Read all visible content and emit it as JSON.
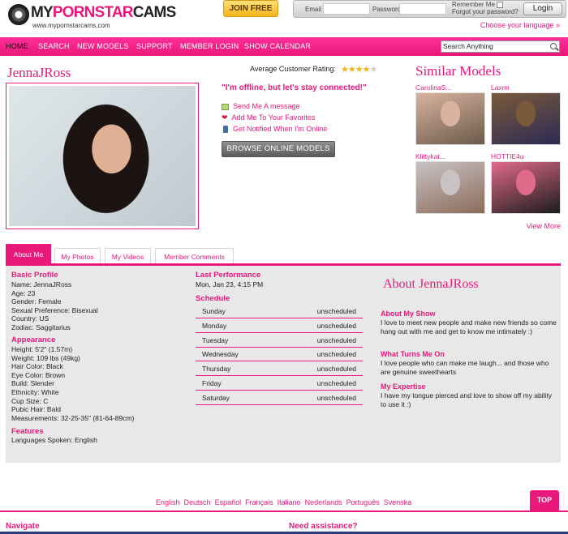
{
  "header": {
    "logo_text_a": "MY",
    "logo_text_b": "PORNSTAR",
    "logo_text_c": "CAMS",
    "logo_url": "www.mypornstarcams.com",
    "join_label": "JOIN FREE",
    "email_label": "Email",
    "password_label": "Password",
    "remember_label": "Remember Me",
    "forgot_label": "Forgot your password?",
    "login_label": "Login",
    "choose_language": "Choose your language »"
  },
  "nav": {
    "items": [
      "HOME",
      "SEARCH",
      "NEW MODELS",
      "SUPPORT",
      "MEMBER LOGIN",
      "SHOW CALENDAR"
    ],
    "search_placeholder": "Search Anything"
  },
  "profile": {
    "name": "JennaJRoss",
    "rating_label": "Average Customer Rating:",
    "rating": 4,
    "rating_max": 5,
    "offline_message": "\"I'm offline, but let's stay connected!\"",
    "actions": [
      "Send Me A message",
      "Add Me To Your Favorites",
      "Get Notified When I'm Online"
    ],
    "browse_label": "BROWSE ONLINE MODELS"
  },
  "similar": {
    "title": "Similar Models",
    "models": [
      {
        "name": "CarolinaS...",
        "color_a": "#d9b3a0",
        "color_b": "#6b5a4a"
      },
      {
        "name": "Laxmi",
        "color_a": "#7a5a3a",
        "color_b": "#2c2a55"
      },
      {
        "name": "Klittykat...",
        "color_a": "#c9c2c4",
        "color_b": "#8b6b5a"
      },
      {
        "name": "HOTTIE4u",
        "color_a": "#e06a8a",
        "color_b": "#1c1c1c"
      }
    ],
    "view_more": "View More"
  },
  "tabs": [
    "About Me",
    "My Photos",
    "My Videos",
    "Member Comments"
  ],
  "basic": {
    "heading": "Basic Profile",
    "lines": [
      "Name: JennaJRoss",
      "Age: 23",
      "Gender: Female",
      "Sexual Preference: Bisexual",
      "Country: US",
      "Zodiac: Saggitarius"
    ]
  },
  "appearance": {
    "heading": "Appearance",
    "lines": [
      "Height: 5'2\" (1.57m)",
      "Weight: 109 lbs (49kg)",
      "Hair Color: Black",
      "Eye Color: Brown",
      "Build: Slender",
      "Ethnicity: White",
      "Cup Size: C",
      "Pubic Hair: Bald",
      "Measurements: 32-25-35\" (81-64-89cm)"
    ]
  },
  "features": {
    "heading": "Features",
    "lines": [
      "Languages Spoken: English"
    ]
  },
  "performance": {
    "heading": "Last Performance",
    "value": "Mon, Jan 23, 4:15 PM"
  },
  "schedule": {
    "heading": "Schedule",
    "rows": [
      {
        "day": "Sunday",
        "value": "unscheduled"
      },
      {
        "day": "Monday",
        "value": "unscheduled"
      },
      {
        "day": "Tuesday",
        "value": "unscheduled"
      },
      {
        "day": "Wednesday",
        "value": "unscheduled"
      },
      {
        "day": "Thursday",
        "value": "unscheduled"
      },
      {
        "day": "Friday",
        "value": "unscheduled"
      },
      {
        "day": "Saturday",
        "value": "unscheduled"
      }
    ]
  },
  "about": {
    "title": "About JennaJRoss",
    "show_heading": "About My Show",
    "show_text": "I love to meet new people and make new friends so come hang out with me and get to know me intimately :)",
    "turns_heading": "What Turns Me On",
    "turns_text": "I love people who can make me laugh... and those who are genuine sweethearts",
    "expertise_heading": "My Expertise",
    "expertise_text": "I have my tongue pierced and love to show off my ability to use it :)"
  },
  "footer": {
    "languages": [
      "English",
      "Deutsch",
      "Español",
      "Français",
      "Italiano",
      "Nederlands",
      "Português",
      "Svenska"
    ],
    "top_label": "TOP",
    "navigate": "Navigate",
    "assistance": "Need assistance?"
  },
  "colors": {
    "accent": "#e8197a",
    "gold": "#f3b21b"
  }
}
